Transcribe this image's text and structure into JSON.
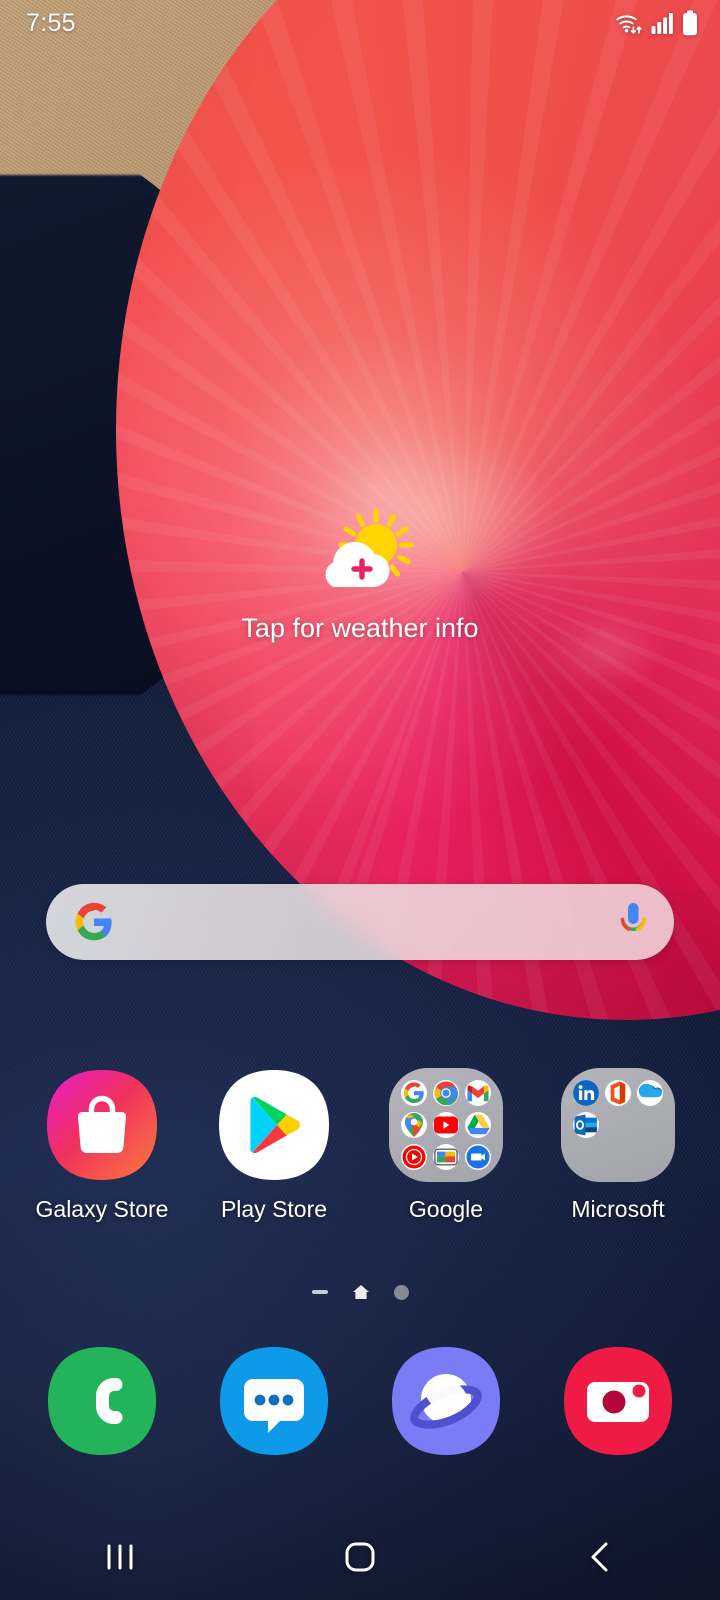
{
  "status_bar": {
    "time": "7:55",
    "icons": [
      "wifi-data-icon",
      "cellular-signal-icon",
      "battery-icon"
    ],
    "signal_bars": 4,
    "battery_level": "full",
    "text_color": "#ffffff"
  },
  "weather_widget": {
    "label": "Tap for weather info",
    "icon": "sun-behind-cloud-plus-icon",
    "sun_color": "#FFD400",
    "cloud_color": "#ffffff",
    "plus_color": "#E8245E"
  },
  "search_bar": {
    "placeholder": "",
    "value": "",
    "left_icon": "google-g-icon",
    "right_icon": "google-microphone-icon",
    "background": "#E8EAEB"
  },
  "app_grid": [
    {
      "label": "Galaxy Store",
      "icon": "galaxy-store-icon",
      "type": "app",
      "colors": [
        "#E01EC8",
        "#F5365C",
        "#F96A3C"
      ]
    },
    {
      "label": "Play Store",
      "icon": "play-store-icon",
      "type": "app",
      "colors": [
        "#00E5FF",
        "#00D65A",
        "#FFCE00",
        "#F4383F"
      ]
    },
    {
      "label": "Google",
      "icon": "folder-icon",
      "type": "folder",
      "apps": [
        "google-search-icon",
        "chrome-icon",
        "gmail-icon",
        "google-maps-icon",
        "youtube-icon",
        "google-drive-icon",
        "youtube-music-icon",
        "google-tv-icon",
        "google-meet-icon"
      ]
    },
    {
      "label": "Microsoft",
      "icon": "folder-icon",
      "type": "folder",
      "apps": [
        "linkedin-icon",
        "microsoft-office-icon",
        "onedrive-icon",
        "outlook-icon"
      ]
    }
  ],
  "page_indicator": {
    "items": [
      "apps-page-dash",
      "home-page-glyph",
      "page-dot"
    ],
    "current": 1,
    "total": 3
  },
  "dock": [
    {
      "label": "Phone",
      "icon": "phone-icon",
      "color": "#23B45B"
    },
    {
      "label": "Messages",
      "icon": "messages-icon",
      "color": "#0D9AEB"
    },
    {
      "label": "Internet",
      "icon": "samsung-internet-icon",
      "color": "#7B7BF5"
    },
    {
      "label": "Camera",
      "icon": "camera-icon",
      "color": "#EF1B45"
    }
  ],
  "nav_bar": {
    "buttons": [
      {
        "name": "recents-button",
        "icon": "recents-icon"
      },
      {
        "name": "home-button",
        "icon": "home-icon"
      },
      {
        "name": "back-button",
        "icon": "back-chevron-icon"
      }
    ]
  },
  "wallpaper": {
    "description": "pink-red exercise ball on navy denim with tan carpet",
    "ball_color": "#E8225E",
    "cloth_color": "#1b2546",
    "carpet_color": "#c2a079"
  }
}
